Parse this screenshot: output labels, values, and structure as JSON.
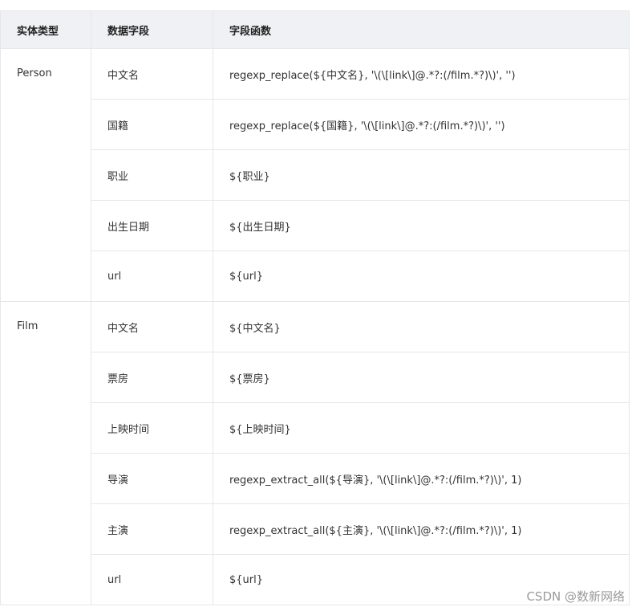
{
  "table": {
    "headers": [
      "实体类型",
      "数据字段",
      "字段函数"
    ],
    "groups": [
      {
        "entity": "Person",
        "rows": [
          {
            "field": "中文名",
            "func": "regexp_replace(${中文名}, '\\(\\[link\\]@.*?:(/film.*?)\\)', '')"
          },
          {
            "field": "国籍",
            "func": "regexp_replace(${国籍}, '\\(\\[link\\]@.*?:(/film.*?)\\)', '')"
          },
          {
            "field": "职业",
            "func": "${职业}"
          },
          {
            "field": "出生日期",
            "func": "${出生日期}"
          },
          {
            "field": "url",
            "func": "${url}"
          }
        ]
      },
      {
        "entity": "Film",
        "rows": [
          {
            "field": "中文名",
            "func": "${中文名}"
          },
          {
            "field": "票房",
            "func": "${票房}"
          },
          {
            "field": "上映时间",
            "func": "${上映时间}"
          },
          {
            "field": "导演",
            "func": "regexp_extract_all(${导演}, '\\(\\[link\\]@.*?:(/film.*?)\\)', 1)"
          },
          {
            "field": "主演",
            "func": "regexp_extract_all(${主演}, '\\(\\[link\\]@.*?:(/film.*?)\\)', 1)"
          },
          {
            "field": "url",
            "func": "${url}"
          }
        ]
      }
    ]
  },
  "watermark": "CSDN @数新网络"
}
